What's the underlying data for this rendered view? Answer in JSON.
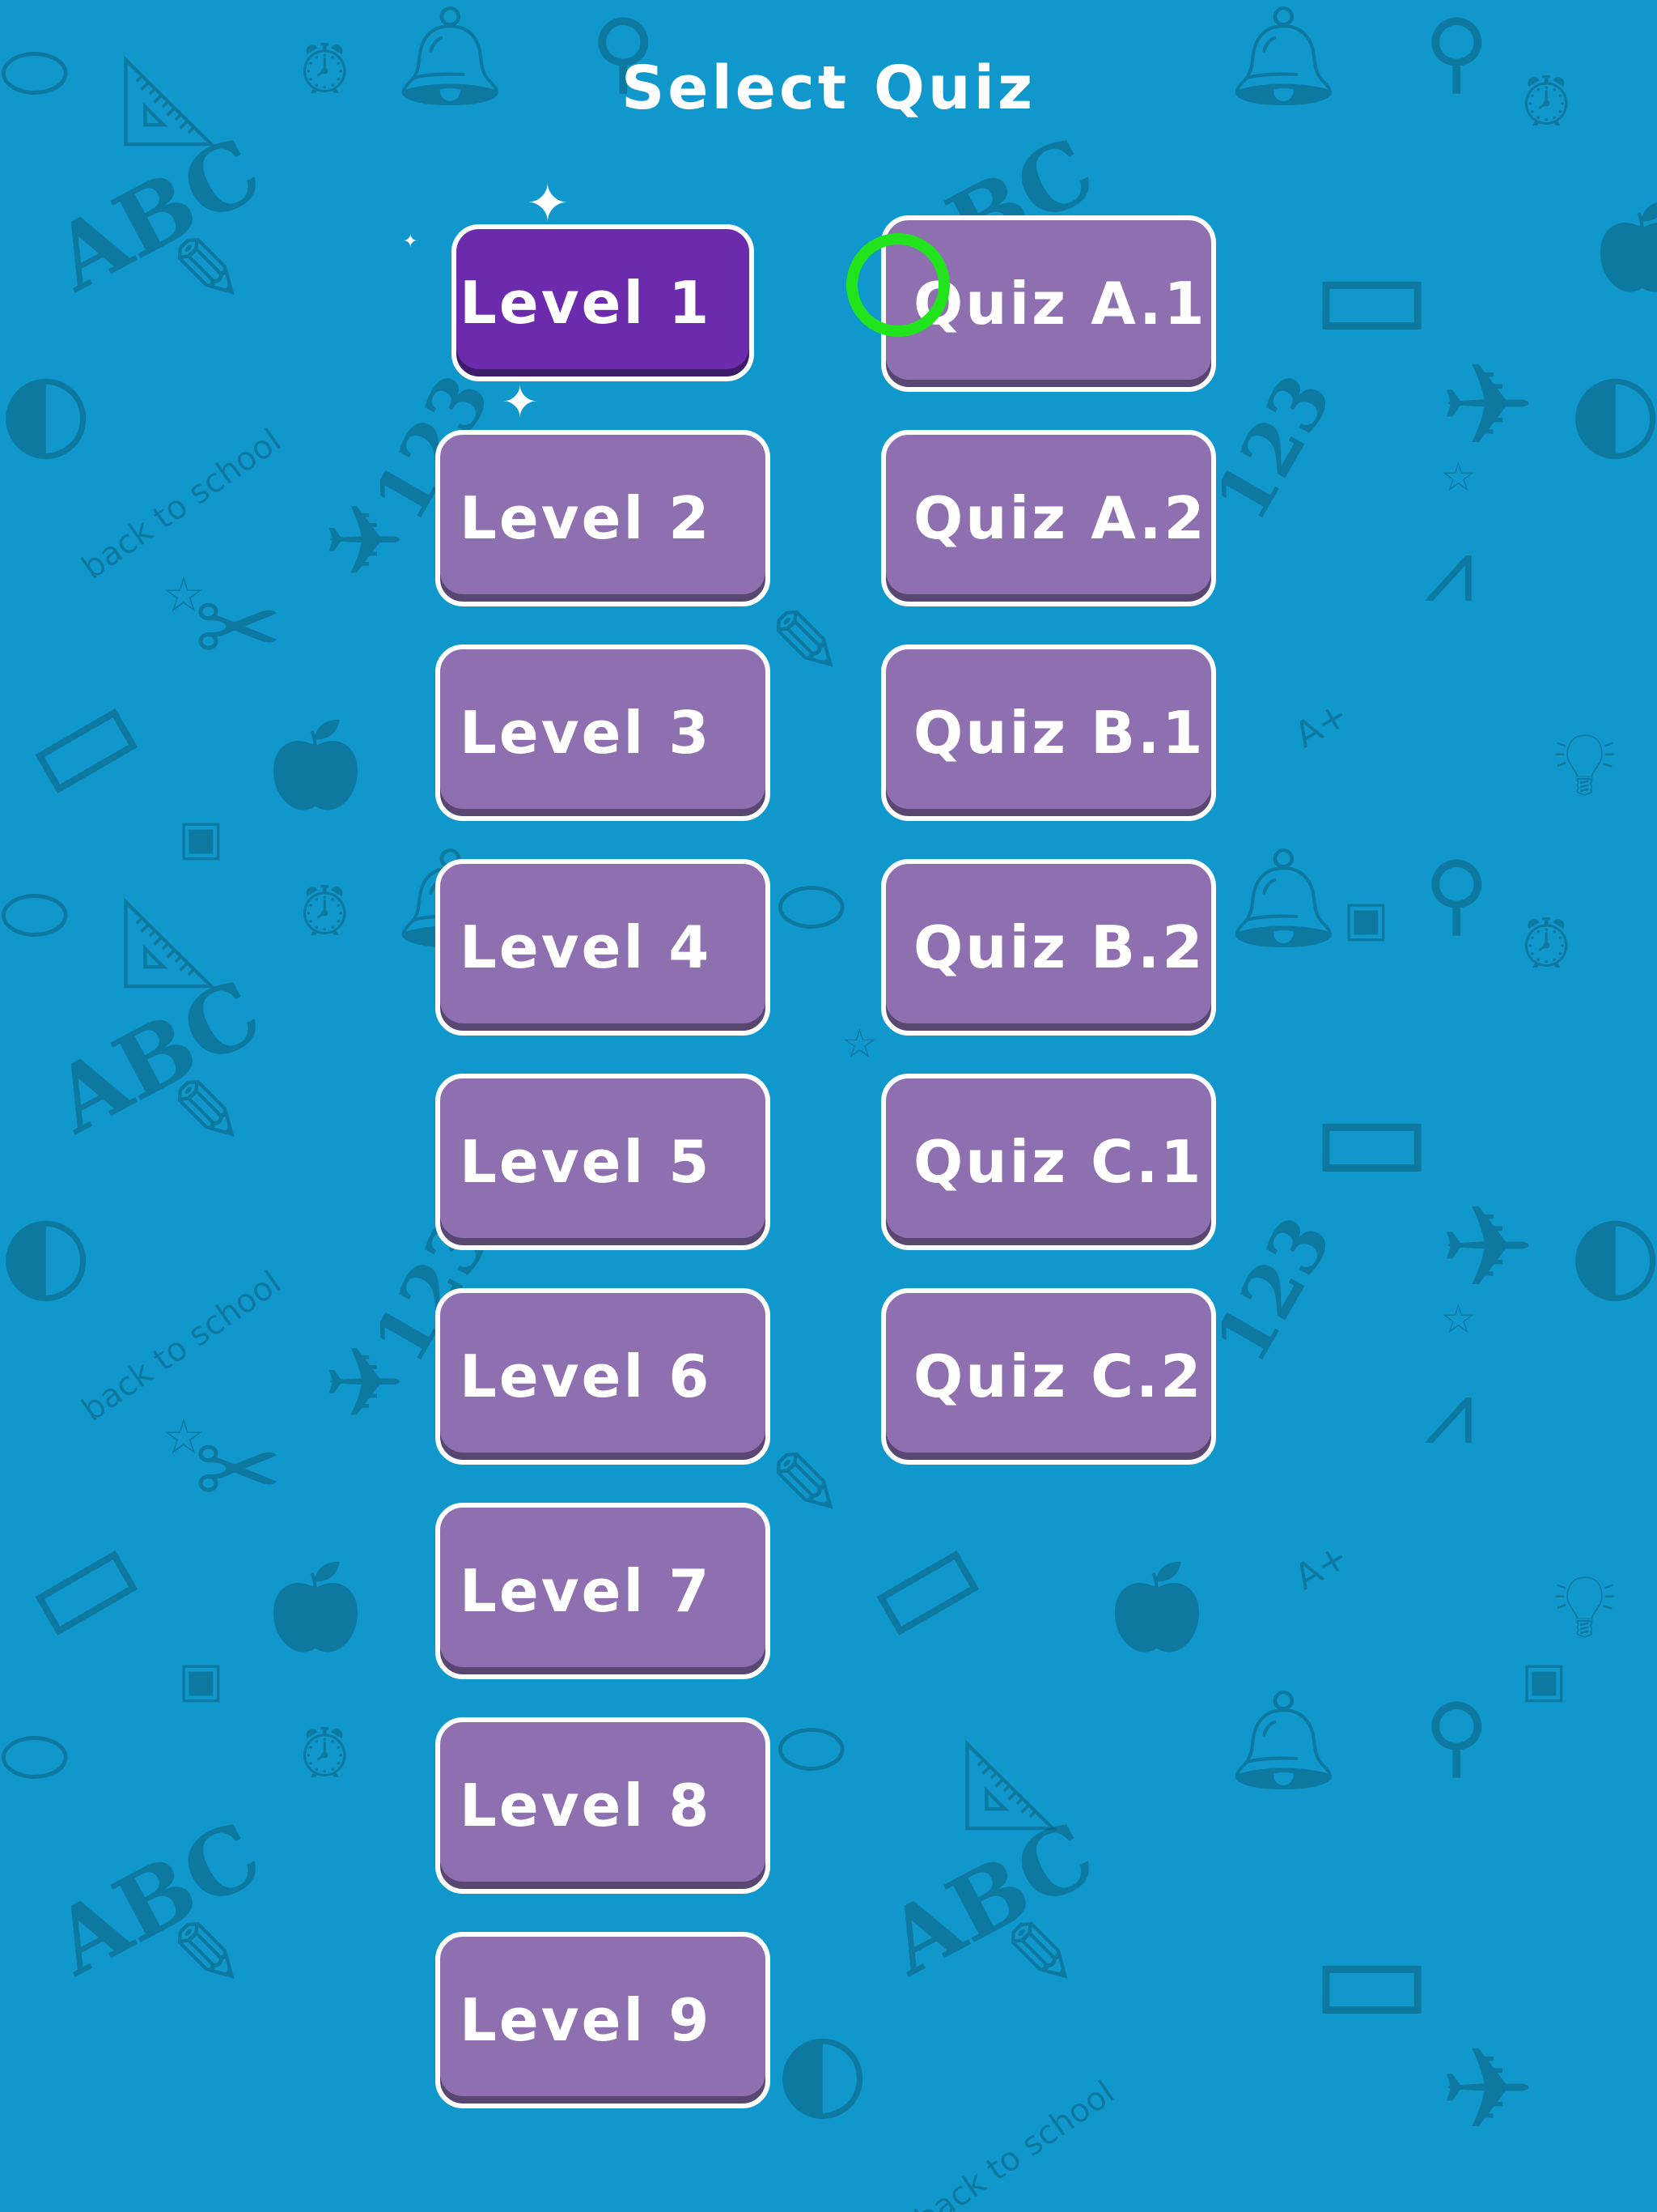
{
  "title": "Select Quiz",
  "levels": [
    {
      "label": "Level 1",
      "selected": true
    },
    {
      "label": "Level 2"
    },
    {
      "label": "Level 3"
    },
    {
      "label": "Level 4"
    },
    {
      "label": "Level 5"
    },
    {
      "label": "Level 6"
    },
    {
      "label": "Level 7"
    },
    {
      "label": "Level 8"
    },
    {
      "label": "Level 9"
    }
  ],
  "quizzes": [
    {
      "label": "Quiz A.1"
    },
    {
      "label": "Quiz A.2"
    },
    {
      "label": "Quiz B.1"
    },
    {
      "label": "Quiz B.2"
    },
    {
      "label": "Quiz C.1"
    },
    {
      "label": "Quiz C.2"
    }
  ],
  "background": {
    "texts": [
      "ABC",
      "123",
      "back to school",
      "A+"
    ],
    "icons": [
      "bell-icon",
      "magnifier-icon",
      "pencil-icon",
      "apple-icon",
      "globe-icon",
      "scissors-icon",
      "paper-plane-icon",
      "notebook-icon",
      "alarm-clock-icon",
      "ruler-icon",
      "lightbulb-icon",
      "compass-icon",
      "sharpener-icon",
      "palette-icon",
      "star-icon"
    ]
  },
  "colors": {
    "background": "#1098cd",
    "button": "#8e70b1",
    "button_selected": "#6c2aad",
    "button_border": "#ffffff",
    "cursor_ring": "#22e41c"
  }
}
